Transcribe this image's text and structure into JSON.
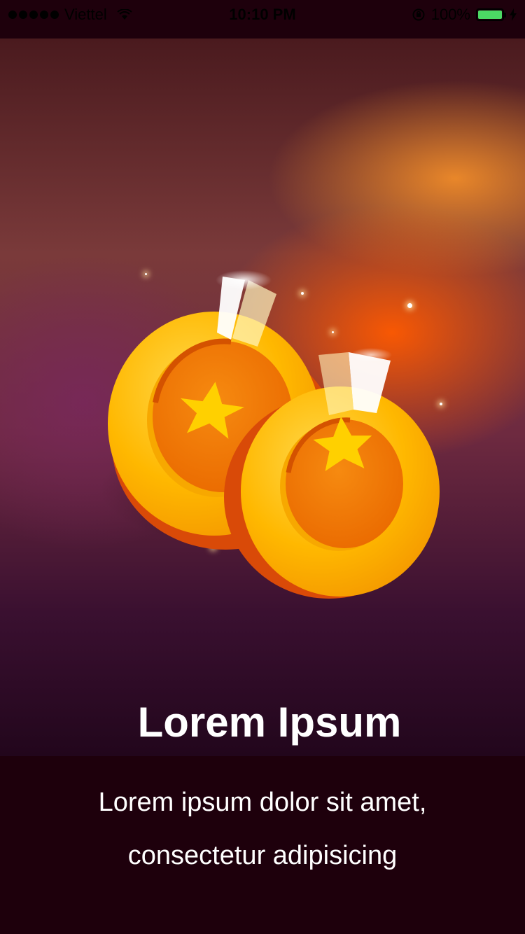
{
  "status_bar": {
    "carrier": "Viettel",
    "time": "10:10 PM",
    "battery_percent": "100%",
    "battery_level": 1.0,
    "battery_color": "#4cd964"
  },
  "hero": {
    "title": "Lorem Ipsum",
    "coin_color": "#ffb800",
    "coin_center_color": "#f07000",
    "star_color": "#ffd000"
  },
  "description": {
    "line1": "Lorem ipsum dolor sit amet,",
    "line2": "consectetur adipisicing"
  },
  "colors": {
    "background": "#1e000c"
  }
}
